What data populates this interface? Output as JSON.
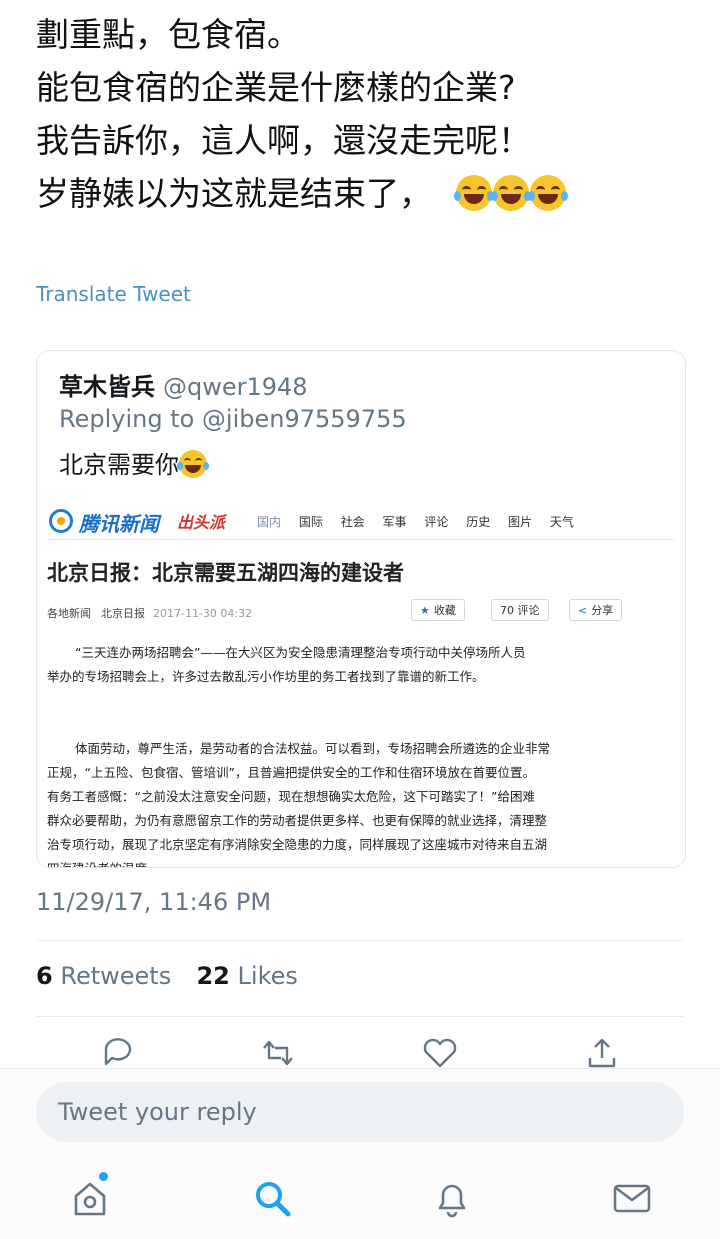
{
  "tweet": {
    "lines": [
      "劃重點，包食宿。",
      "能包食宿的企業是什麼樣的企業?",
      "我告訴你，這人啊，還沒走完呢！",
      "岁静婊以为这就是结束了，"
    ],
    "emoji": [
      "face-with-tears-of-joy",
      "face-with-tears-of-joy",
      "face-with-tears-of-joy"
    ]
  },
  "translate_link": "Translate Tweet",
  "quoted": {
    "name": "草木皆兵",
    "handle": "@qwer1948",
    "replying": "Replying to @jiben97559755",
    "text": "北京需要你",
    "article": {
      "logo_text": "腾讯新闻",
      "logo_tag": "出头派",
      "nav_dim": [
        "国内"
      ],
      "nav": [
        "国际",
        "社会",
        "军事",
        "评论",
        "历史",
        "图片",
        "天气"
      ],
      "title": "北京日报：北京需要五湖四海的建设者",
      "meta_category": "各地新闻",
      "meta_source": "北京日报",
      "meta_date": "2017-11-30 04:32",
      "btn_collect": "收藏",
      "btn_comment": "70 评论",
      "btn_share": "分享",
      "para1_l1": "“三天连办两场招聘会”——在大兴区为安全隐患清理整治专项行动中关停场所人员",
      "para1_l2": "举办的专场招聘会上，许多过去散乱污小作坊里的务工者找到了靠谱的新工作。",
      "para2_l1": "体面劳动，尊严生活，是劳动者的合法权益。可以看到，专场招聘会所遴选的企业非常",
      "para2_l2": "正规，“上五险、包食宿、管培训”，且普遍把提供安全的工作和住宿环境放在首要位置。",
      "para2_l3": "有务工者感慨：“之前没太注意安全问题，现在想想确实太危险，这下可踏实了！”给困难",
      "para2_l4": "群众必要帮助，为仍有意愿留京工作的劳动者提供更多样、也更有保障的就业选择，清理整",
      "para2_l5": "治专项行动，展现了北京坚定有序消除安全隐患的力度，同样展现了这座城市对待来自五湖",
      "para2_l6": "四海建设者的温度。"
    }
  },
  "timestamp": "11/29/17, 11:46 PM",
  "stats": {
    "retweets_count": "6",
    "retweets_label": "Retweets",
    "likes_count": "22",
    "likes_label": "Likes"
  },
  "actions": [
    "reply-icon",
    "retweet-icon",
    "like-icon",
    "share-icon"
  ],
  "reply_placeholder": "Tweet your reply",
  "tabs": [
    "home-icon",
    "search-icon",
    "notifications-icon",
    "messages-icon"
  ],
  "colors": {
    "accent": "#1da1f2",
    "link": "#4a90c4",
    "muted": "#657786"
  }
}
